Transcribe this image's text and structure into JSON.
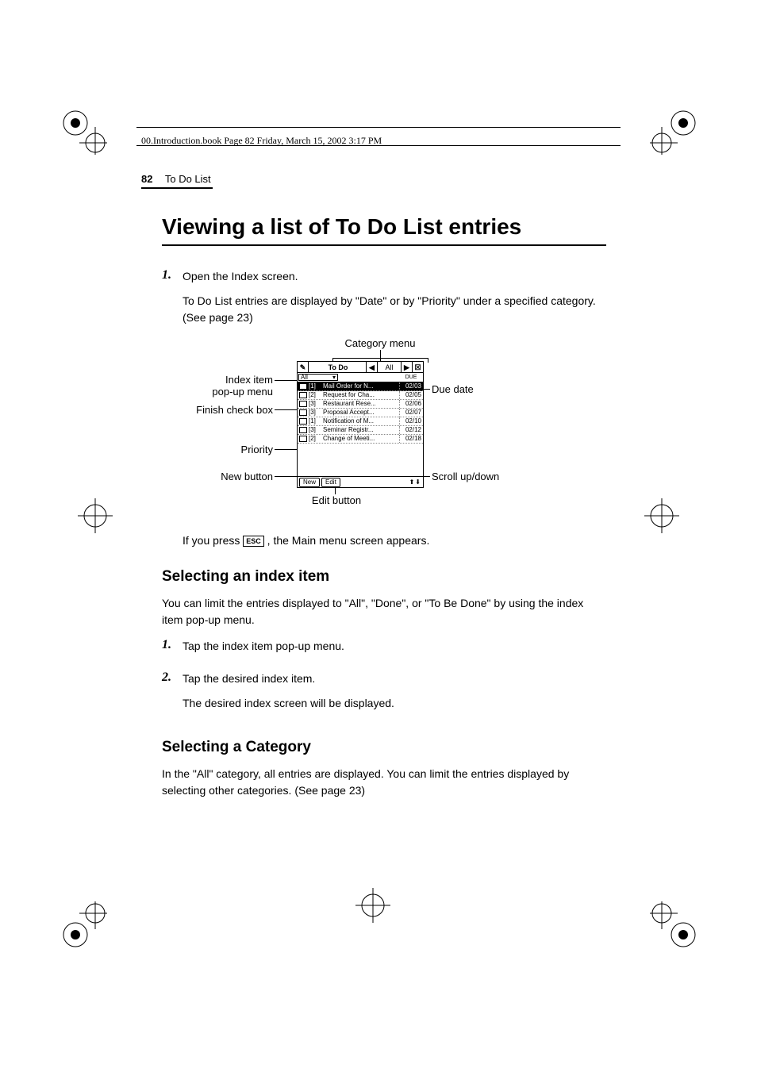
{
  "header": {
    "source_line": "00.Introduction.book  Page 82  Friday, March 15, 2002  3:17 PM",
    "page_number": "82",
    "section_name": "To Do List"
  },
  "h1": "Viewing a list of To Do List entries",
  "step1": {
    "num": "1.",
    "text": "Open the Index screen.",
    "desc": "To Do List entries are displayed by \"Date\" or by \"Priority\" under a specified category. (See page 23)"
  },
  "figure": {
    "callouts": {
      "category_menu": "Category menu",
      "index_item": "Index item",
      "popup_menu": "pop-up menu",
      "finish_checkbox": "Finish check box",
      "priority": "Priority",
      "new_button": "New button",
      "edit_button": "Edit button",
      "due_date": "Due date",
      "scroll": "Scroll up/down"
    },
    "screen": {
      "title": "To Do",
      "category": "All",
      "popup_value": "All",
      "due_header": "DUE",
      "rows": [
        {
          "priority": "[1]",
          "title": "Mail Order for N...",
          "date": "02/03",
          "sel": true
        },
        {
          "priority": "[2]",
          "title": "Request for Cha...",
          "date": "02/05",
          "sel": false
        },
        {
          "priority": "[3]",
          "title": "Restaurant Rese...",
          "date": "02/06",
          "sel": false
        },
        {
          "priority": "[3]",
          "title": "Proposal Accept...",
          "date": "02/07",
          "sel": false
        },
        {
          "priority": "[1]",
          "title": "Notification of M...",
          "date": "02/10",
          "sel": false
        },
        {
          "priority": "[3]",
          "title": "Seminar Registr...",
          "date": "02/12",
          "sel": false
        },
        {
          "priority": "[2]",
          "title": "Change of Meeti...",
          "date": "02/18",
          "sel": false
        }
      ],
      "new_btn": "New",
      "edit_btn": "Edit"
    }
  },
  "esc_para_pre": "If you press ",
  "esc_label": "ESC",
  "esc_para_post": ", the Main menu screen appears.",
  "h2a": "Selecting an index item",
  "para_a": "You can limit the entries displayed to \"All\", \"Done\", or \"To Be Done\" by using the index item pop-up menu.",
  "step_a1": {
    "num": "1.",
    "text": "Tap the index item pop-up menu."
  },
  "step_a2": {
    "num": "2.",
    "text": "Tap the desired index item.",
    "desc": "The desired index screen will be displayed."
  },
  "h2b": "Selecting a Category",
  "para_b": "In the \"All\" category, all entries are displayed. You can limit the entries displayed by selecting other categories. (See page 23)"
}
